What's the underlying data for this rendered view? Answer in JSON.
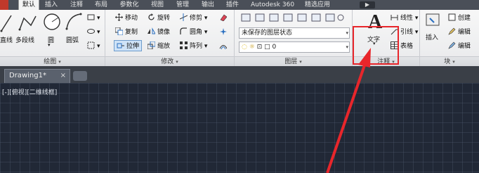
{
  "menu": {
    "tabs": [
      "默认",
      "插入",
      "注释",
      "布局",
      "参数化",
      "视图",
      "管理",
      "输出",
      "插件",
      "Autodesk 360",
      "精选应用"
    ],
    "extra": "▶"
  },
  "draw_group": {
    "title": "绘图",
    "polyline": "多段线",
    "line": "直线",
    "circle": "圆",
    "arc": "圆弧"
  },
  "modify_group": {
    "title": "修改",
    "move": "移动",
    "rotate": "旋转",
    "trim": "修剪",
    "copy": "复制",
    "mirror": "镜像",
    "fillet": "圆角",
    "stretch": "拉伸",
    "scale": "缩放",
    "array": "阵列"
  },
  "layers_group": {
    "title": "图层",
    "layer_state": "未保存的图层状态",
    "current_layer": "0"
  },
  "annotation_group": {
    "title": "注释",
    "text_button": "文字",
    "text_glyph": "A",
    "linear": "线性",
    "leader": "引线",
    "table": "表格"
  },
  "block_group": {
    "title": "块",
    "insert": "插入",
    "create": "创建",
    "edit": "编辑",
    "edit_attr": "编辑"
  },
  "document": {
    "tab_name": "Drawing1*",
    "close": "×"
  },
  "viewport": {
    "label": "[-][俯视][二维线框]"
  },
  "colors": {
    "highlight": "#e8262b",
    "arrow": "#e8262b",
    "canvas": "#212836"
  }
}
